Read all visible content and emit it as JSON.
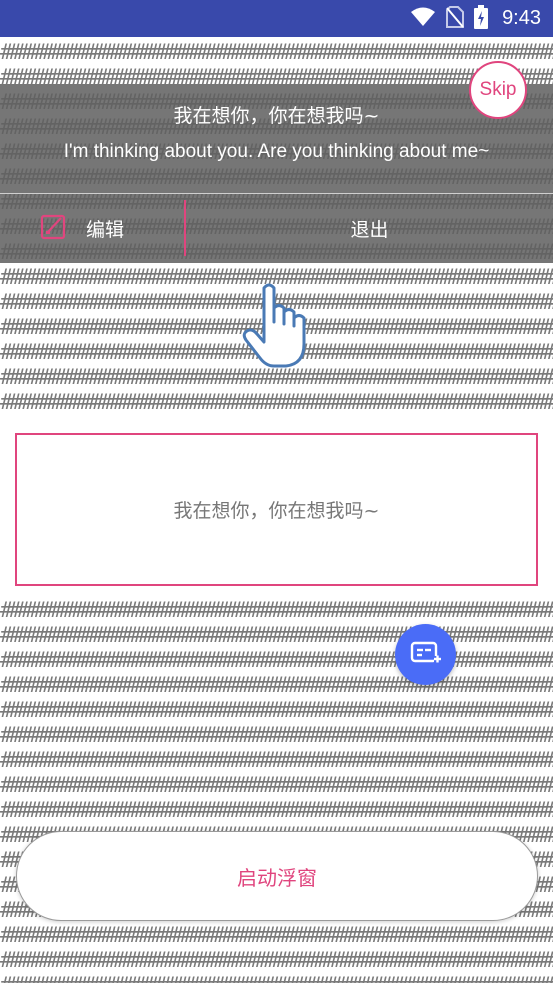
{
  "status_bar": {
    "time": "9:43",
    "icons": [
      "wifi-icon",
      "no-sim-icon",
      "battery-charging-icon"
    ],
    "background": "#3949ab"
  },
  "background_pattern": {
    "char": "#",
    "color": "#7a7a7a"
  },
  "floating_bar": {
    "text_cn": "我在想你，你在想我吗~",
    "text_en": "I'm thinking about you. Are you thinking about me~",
    "edit_label": "编辑",
    "exit_label": "退出",
    "skip_label": "Skip"
  },
  "hint": {
    "icon": "pointing-hand-icon"
  },
  "preview_card": {
    "text": "我在想你，你在想我吗~"
  },
  "fab": {
    "icon": "add-subtitle-icon"
  },
  "launch_button": {
    "label": "启动浮窗"
  },
  "colors": {
    "accent": "#e0457e",
    "fab": "#4a6cf7",
    "overlay": "#5f5f5f"
  }
}
